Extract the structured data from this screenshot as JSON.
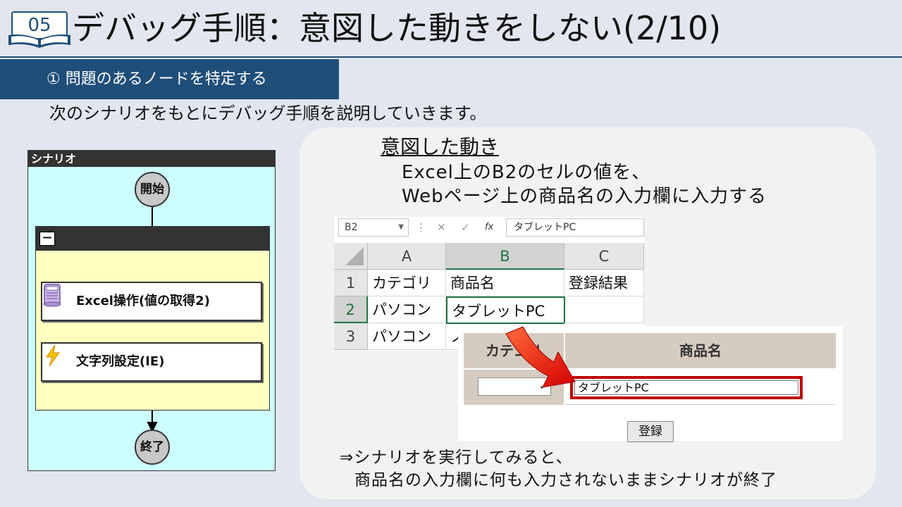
{
  "header": {
    "page_number": "05",
    "title": "デバッグ手順：意図した動きをしない(2/10)"
  },
  "section": {
    "label": "① 問題のあるノードを特定する"
  },
  "intro": "次のシナリオをもとにデバッグ手順を説明していきます。",
  "scenario": {
    "panel_title": "シナリオ",
    "start_label": "開始",
    "end_label": "終了",
    "collapse_symbol": "−",
    "nodes": [
      {
        "label": "Excel操作(値の取得2)",
        "icon": "excel-scroll-icon"
      },
      {
        "label": "文字列設定(IE)",
        "icon": "lightning-icon"
      }
    ]
  },
  "intent": {
    "title": "意図した動き",
    "line1": "Excel上のB2のセルの値を、",
    "line2": "Webページ上の商品名の入力欄に入力する"
  },
  "excel": {
    "name_box": "B2",
    "formula_buttons": [
      "⋮",
      "✕",
      "✓",
      "fx"
    ],
    "formula_value": "タブレットPC",
    "columns": [
      "A",
      "B",
      "C"
    ],
    "rows": [
      {
        "num": "1",
        "cells": [
          "カテゴリ",
          "商品名",
          "登録結果"
        ]
      },
      {
        "num": "2",
        "cells": [
          "パソコン",
          "タブレットPC",
          ""
        ]
      },
      {
        "num": "3",
        "cells": [
          "パソコン",
          "ノ",
          ""
        ]
      }
    ],
    "active_cell": "B2"
  },
  "webform": {
    "col_category": "カテゴリ",
    "col_product": "商品名",
    "select_value": "✓",
    "input_value": "タブレットPC",
    "submit_label": "登録"
  },
  "result": {
    "line1": "⇒シナリオを実行してみると、",
    "line2": "商品名の入力欄に何も入力されないままシナリオが終了"
  },
  "colors": {
    "accent": "#1f4e79",
    "scenario_bg": "#ccffff",
    "group_bg": "#ffffc0",
    "highlight": "#c00000",
    "excel_green": "#217346"
  }
}
